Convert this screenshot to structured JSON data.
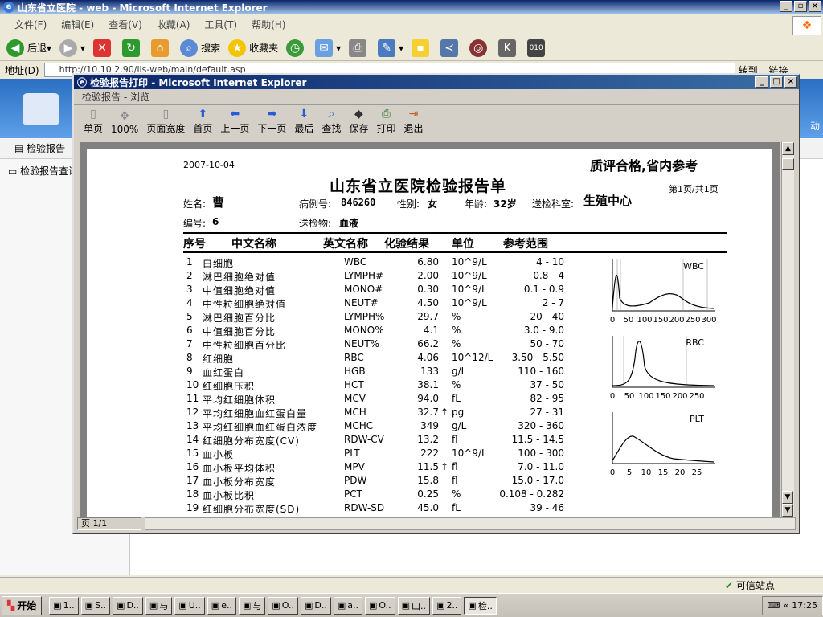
{
  "browser": {
    "title": "山东省立医院 - web - Microsoft Internet Explorer",
    "menu": [
      "文件(F)",
      "编辑(E)",
      "查看(V)",
      "收藏(A)",
      "工具(T)",
      "帮助(H)"
    ],
    "toolbar": {
      "back": "后退",
      "search": "搜索",
      "favorites": "收藏夹"
    },
    "address_label": "地址(D)",
    "address_value": "http://10.10.2.90/lis-web/main/default.asp",
    "go_label": "转到",
    "links_label": "链接"
  },
  "background_page": {
    "nav_item": "检验报告",
    "side_item": "检验报告查询",
    "header_right": "动"
  },
  "dialog": {
    "title": "检验报告打印 - Microsoft Internet Explorer",
    "subtitle": "检验报告 - 浏览",
    "toolbar": [
      "单页",
      "100%",
      "页面宽度",
      "首页",
      "上一页",
      "下一页",
      "最后",
      "查找",
      "保存",
      "打印",
      "退出"
    ],
    "page_status": "页 1/1"
  },
  "report": {
    "date": "2007-10-04",
    "quality": "质评合格,省内参考",
    "title": "山东省立医院检验报告单",
    "page": "第1页/共1页",
    "name_label": "姓名:",
    "name": "曹",
    "case_label": "病例号:",
    "case_no": "846260",
    "sex_label": "性别:",
    "sex": "女",
    "age_label": "年龄:",
    "age": "32岁",
    "dept_label": "送检科室:",
    "dept": "生殖中心",
    "id_label": "编号:",
    "id": "6",
    "sample_label": "送检物:",
    "sample": "血液",
    "headers": [
      "序号",
      "中文名称",
      "英文名称",
      "化验结果",
      "单位",
      "参考范围"
    ],
    "rows": [
      [
        "1",
        "白细胞",
        "WBC",
        "6.80",
        "",
        "10^9/L",
        "4 - 10"
      ],
      [
        "2",
        "淋巴细胞绝对值",
        "LYMPH#",
        "2.00",
        "",
        "10^9/L",
        "0.8 - 4"
      ],
      [
        "3",
        "中值细胞绝对值",
        "MONO#",
        "0.30",
        "",
        "10^9/L",
        "0.1 - 0.9"
      ],
      [
        "4",
        "中性粒细胞绝对值",
        "NEUT#",
        "4.50",
        "",
        "10^9/L",
        "2 - 7"
      ],
      [
        "5",
        "淋巴细胞百分比",
        "LYMPH%",
        "29.7",
        "",
        "%",
        "20 - 40"
      ],
      [
        "6",
        "中值细胞百分比",
        "MONO%",
        "4.1",
        "",
        "%",
        "3.0 - 9.0"
      ],
      [
        "7",
        "中性粒细胞百分比",
        "NEUT%",
        "66.2",
        "",
        "%",
        "50 - 70"
      ],
      [
        "8",
        "红细胞",
        "RBC",
        "4.06",
        "",
        "10^12/L",
        "3.50 - 5.50"
      ],
      [
        "9",
        "血红蛋白",
        "HGB",
        "133",
        "",
        "g/L",
        "110 - 160"
      ],
      [
        "10",
        "红细胞压积",
        "HCT",
        "38.1",
        "",
        "%",
        "37 - 50"
      ],
      [
        "11",
        "平均红细胞体积",
        "MCV",
        "94.0",
        "",
        "fL",
        "82 - 95"
      ],
      [
        "12",
        "平均红细胞血红蛋白量",
        "MCH",
        "32.7",
        "↑",
        "pg",
        "27 - 31"
      ],
      [
        "13",
        "平均红细胞血红蛋白浓度",
        "MCHC",
        "349",
        "",
        "g/L",
        "320 - 360"
      ],
      [
        "14",
        "红细胞分布宽度(CV)",
        "RDW-CV",
        "13.2",
        "",
        "fl",
        "11.5 - 14.5"
      ],
      [
        "15",
        "血小板",
        "PLT",
        "222",
        "",
        "10^9/L",
        "100 - 300"
      ],
      [
        "16",
        "血小板平均体积",
        "MPV",
        "11.5",
        "↑",
        "fl",
        "7.0 - 11.0"
      ],
      [
        "17",
        "血小板分布宽度",
        "PDW",
        "15.8",
        "",
        "fl",
        "15.0 - 17.0"
      ],
      [
        "18",
        "血小板比积",
        "PCT",
        "0.25",
        "",
        "%",
        "0.108 - 0.282"
      ],
      [
        "19",
        "红细胞分布宽度(SD)",
        "RDW-SD",
        "45.0",
        "",
        "fL",
        "39 - 46"
      ]
    ],
    "histograms": [
      {
        "label": "WBC",
        "ticks": [
          "0",
          "50",
          "100",
          "150",
          "200",
          "250",
          "300"
        ]
      },
      {
        "label": "RBC",
        "ticks": [
          "0",
          "50",
          "100",
          "150",
          "200",
          "250"
        ]
      },
      {
        "label": "PLT",
        "ticks": [
          "0",
          "5",
          "10",
          "15",
          "20",
          "25"
        ]
      }
    ]
  },
  "status": {
    "zone": "可信站点"
  },
  "taskbar": {
    "start": "开始",
    "tasks": [
      "1..",
      "S..",
      "D..",
      "与",
      "U..",
      "e..",
      "与",
      "O..",
      "D..",
      "a..",
      "O..",
      "山..",
      "2..",
      "检.."
    ],
    "clock": "17:25"
  }
}
